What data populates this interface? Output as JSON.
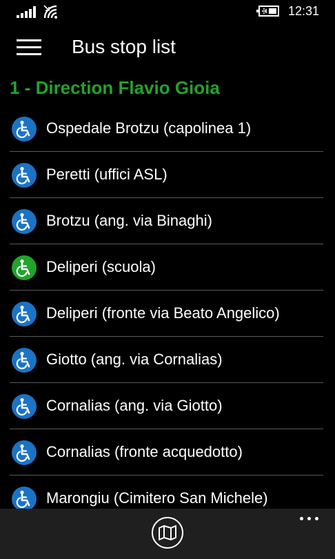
{
  "status_bar": {
    "time": "12:31",
    "icons": [
      "signal-bars-icon",
      "wifi-icon",
      "battery-charging-icon"
    ]
  },
  "header": {
    "title": "Bus stop list",
    "menu_icon": "hamburger-menu-icon"
  },
  "direction": {
    "title": "1 - Direction Flavio Gioia"
  },
  "stops": [
    {
      "name": "Ospedale Brotzu (capolinea 1)",
      "icon": "wheelchair-accessible-icon",
      "icon_color": "#1b73c4"
    },
    {
      "name": "Peretti (uffici ASL)",
      "icon": "wheelchair-accessible-icon",
      "icon_color": "#1b73c4"
    },
    {
      "name": "Brotzu (ang. via Binaghi)",
      "icon": "wheelchair-accessible-icon",
      "icon_color": "#1b73c4"
    },
    {
      "name": "Deliperi (scuola)",
      "icon": "wheelchair-accessible-icon",
      "icon_color": "#22a32b"
    },
    {
      "name": "Deliperi (fronte via Beato Angelico)",
      "icon": "wheelchair-accessible-icon",
      "icon_color": "#1b73c4"
    },
    {
      "name": "Giotto (ang. via Cornalias)",
      "icon": "wheelchair-accessible-icon",
      "icon_color": "#1b73c4"
    },
    {
      "name": "Cornalias (ang. via Giotto)",
      "icon": "wheelchair-accessible-icon",
      "icon_color": "#1b73c4"
    },
    {
      "name": "Cornalias (fronte acquedotto)",
      "icon": "wheelchair-accessible-icon",
      "icon_color": "#1b73c4"
    },
    {
      "name": "Marongiu (Cimitero San Michele)",
      "icon": "wheelchair-accessible-icon",
      "icon_color": "#1b73c4"
    }
  ],
  "app_bar": {
    "primary_icon": "map-icon",
    "more_icon": "more-ellipsis-icon"
  },
  "colors": {
    "background": "#000000",
    "accent_green": "#22a32b",
    "icon_blue": "#1b73c4",
    "divider": "#5a5a5a",
    "app_bar": "#1f1f1f"
  }
}
